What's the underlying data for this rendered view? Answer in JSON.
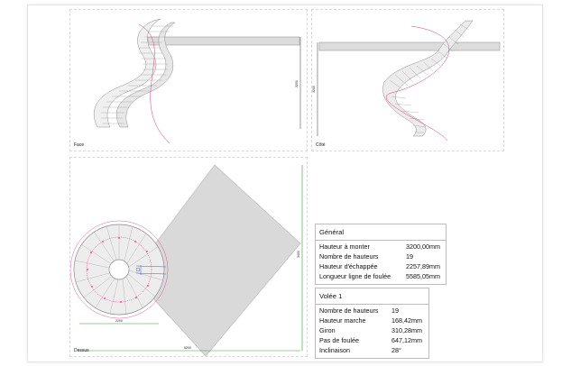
{
  "views": {
    "face": {
      "label": "Face",
      "height_dim": "3200"
    },
    "cote": {
      "label": "Côté",
      "height_dim": "3200"
    },
    "dessus": {
      "label": "Dessus",
      "dim_bottom": "2200",
      "dim_total": "5200",
      "dim_right": "3400"
    }
  },
  "general": {
    "title": "Général",
    "rows": [
      {
        "label": "Hauteur à monter",
        "value": "3200,00mm"
      },
      {
        "label": "Nombre de hauteurs",
        "value": "19"
      },
      {
        "label": "Hauteur d'échappée",
        "value": "2257,89mm"
      },
      {
        "label": "Longueur ligne de foulée",
        "value": "5585,05mm"
      }
    ]
  },
  "volee": {
    "title": "Volée 1",
    "rows": [
      {
        "label": "Nombre de hauteurs",
        "value": "19"
      },
      {
        "label": "Hauteur marche",
        "value": "168,42mm"
      },
      {
        "label": "Giron",
        "value": "310,28mm"
      },
      {
        "label": "Pas de foulée",
        "value": "647,12mm"
      },
      {
        "label": "Inclinaison",
        "value": "28°"
      }
    ]
  },
  "colors": {
    "guide": "#e8307a",
    "dimension": "#2aa12a",
    "stair": "#8c8c8c",
    "slab": "#d9d9d9",
    "marker": "#5a4fcf"
  }
}
